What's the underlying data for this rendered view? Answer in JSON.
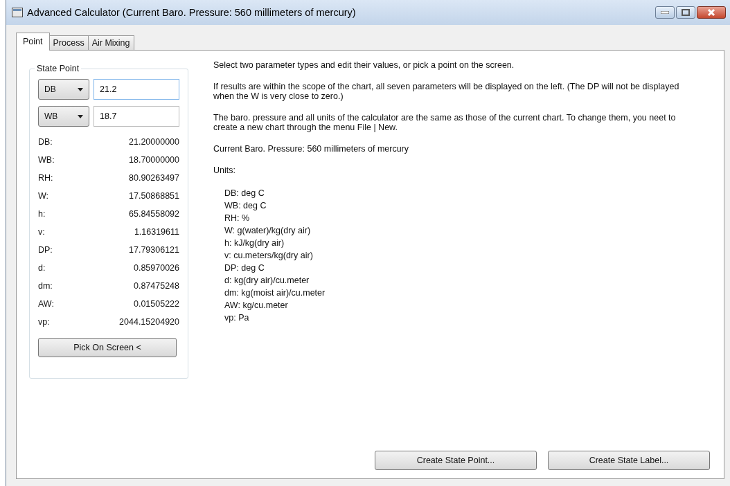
{
  "window": {
    "title": "Advanced Calculator (Current Baro. Pressure: 560 millimeters of mercury)"
  },
  "tabs": [
    {
      "label": "Point",
      "selected": true
    },
    {
      "label": "Process",
      "selected": false
    },
    {
      "label": "Air Mixing",
      "selected": false
    }
  ],
  "state_point": {
    "title": "State Point",
    "inputs": [
      {
        "parameter": "DB",
        "value": "21.2",
        "focused": true
      },
      {
        "parameter": "WB",
        "value": "18.7",
        "focused": false
      }
    ],
    "results": [
      {
        "label": "DB:",
        "value": "21.20000000"
      },
      {
        "label": "WB:",
        "value": "18.70000000"
      },
      {
        "label": "RH:",
        "value": "80.90263497"
      },
      {
        "label": "W:",
        "value": "17.50868851"
      },
      {
        "label": "h:",
        "value": "65.84558092"
      },
      {
        "label": "v:",
        "value": "1.16319611"
      },
      {
        "label": "DP:",
        "value": "17.79306121"
      },
      {
        "label": "d:",
        "value": "0.85970026"
      },
      {
        "label": "dm:",
        "value": "0.87475248"
      },
      {
        "label": "AW:",
        "value": "0.01505222"
      },
      {
        "label": "vp:",
        "value": "2044.15204920"
      }
    ],
    "pick_button": "Pick On Screen <"
  },
  "info": {
    "paragraphs": [
      "Select two parameter types and edit their values, or pick a point on the screen.",
      "If results are within the scope of the chart, all seven parameters will be displayed on the left. (The DP will not be displayed when the W is very close to zero.)",
      "The baro. pressure and all units of the calculator are the same as those of the current chart. To change them, you neet to create a new chart through the menu File | New.",
      "Current Baro. Pressure: 560 millimeters of mercury",
      "Units:"
    ],
    "units": [
      "DB: deg C",
      "WB: deg C",
      "RH: %",
      "W: g(water)/kg(dry air)",
      "h: kJ/kg(dry air)",
      "v: cu.meters/kg(dry air)",
      "DP: deg C",
      "d: kg(dry air)/cu.meter",
      "dm: kg(moist air)/cu.meter",
      "AW: kg/cu.meter",
      "vp: Pa"
    ]
  },
  "buttons": [
    "Create State Point...",
    "Create State Label..."
  ]
}
